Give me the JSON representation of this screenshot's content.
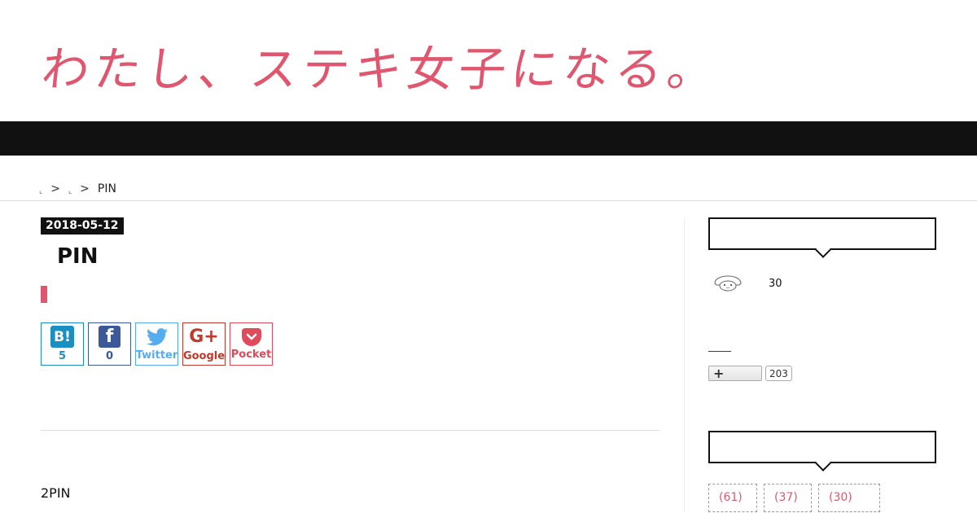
{
  "site": {
    "title": "わたし、ステキ女子になる。"
  },
  "breadcrumb": {
    "sep1": ">",
    "sep2": ">",
    "current": "PIN"
  },
  "post": {
    "date": "2018-05-12",
    "title": "PIN",
    "body": "2PIN"
  },
  "share": {
    "hatena": {
      "icon": "B!",
      "count": "5"
    },
    "facebook": {
      "icon": "f",
      "count": "0"
    },
    "twitter": {
      "label": "Twitter"
    },
    "google": {
      "icon": "G+",
      "label": "Google"
    },
    "pocket": {
      "label": "Pocket"
    }
  },
  "sidebar": {
    "followers": "30",
    "follow_count": "203",
    "tags": [
      "(61)",
      "(37)",
      "(30)"
    ]
  },
  "colors": {
    "accent": "#e0566e",
    "nav": "#111111",
    "hatena": "#1b8fc2",
    "facebook": "#3b5998",
    "twitter": "#55acee",
    "google": "#c0392b",
    "pocket": "#e04b5c"
  },
  "icons": {
    "hatena": "hatena-bookmark-icon",
    "facebook": "facebook-icon",
    "twitter": "twitter-bird-icon",
    "google": "google-plus-icon",
    "pocket": "pocket-icon",
    "avatar": "avatar-icon"
  }
}
